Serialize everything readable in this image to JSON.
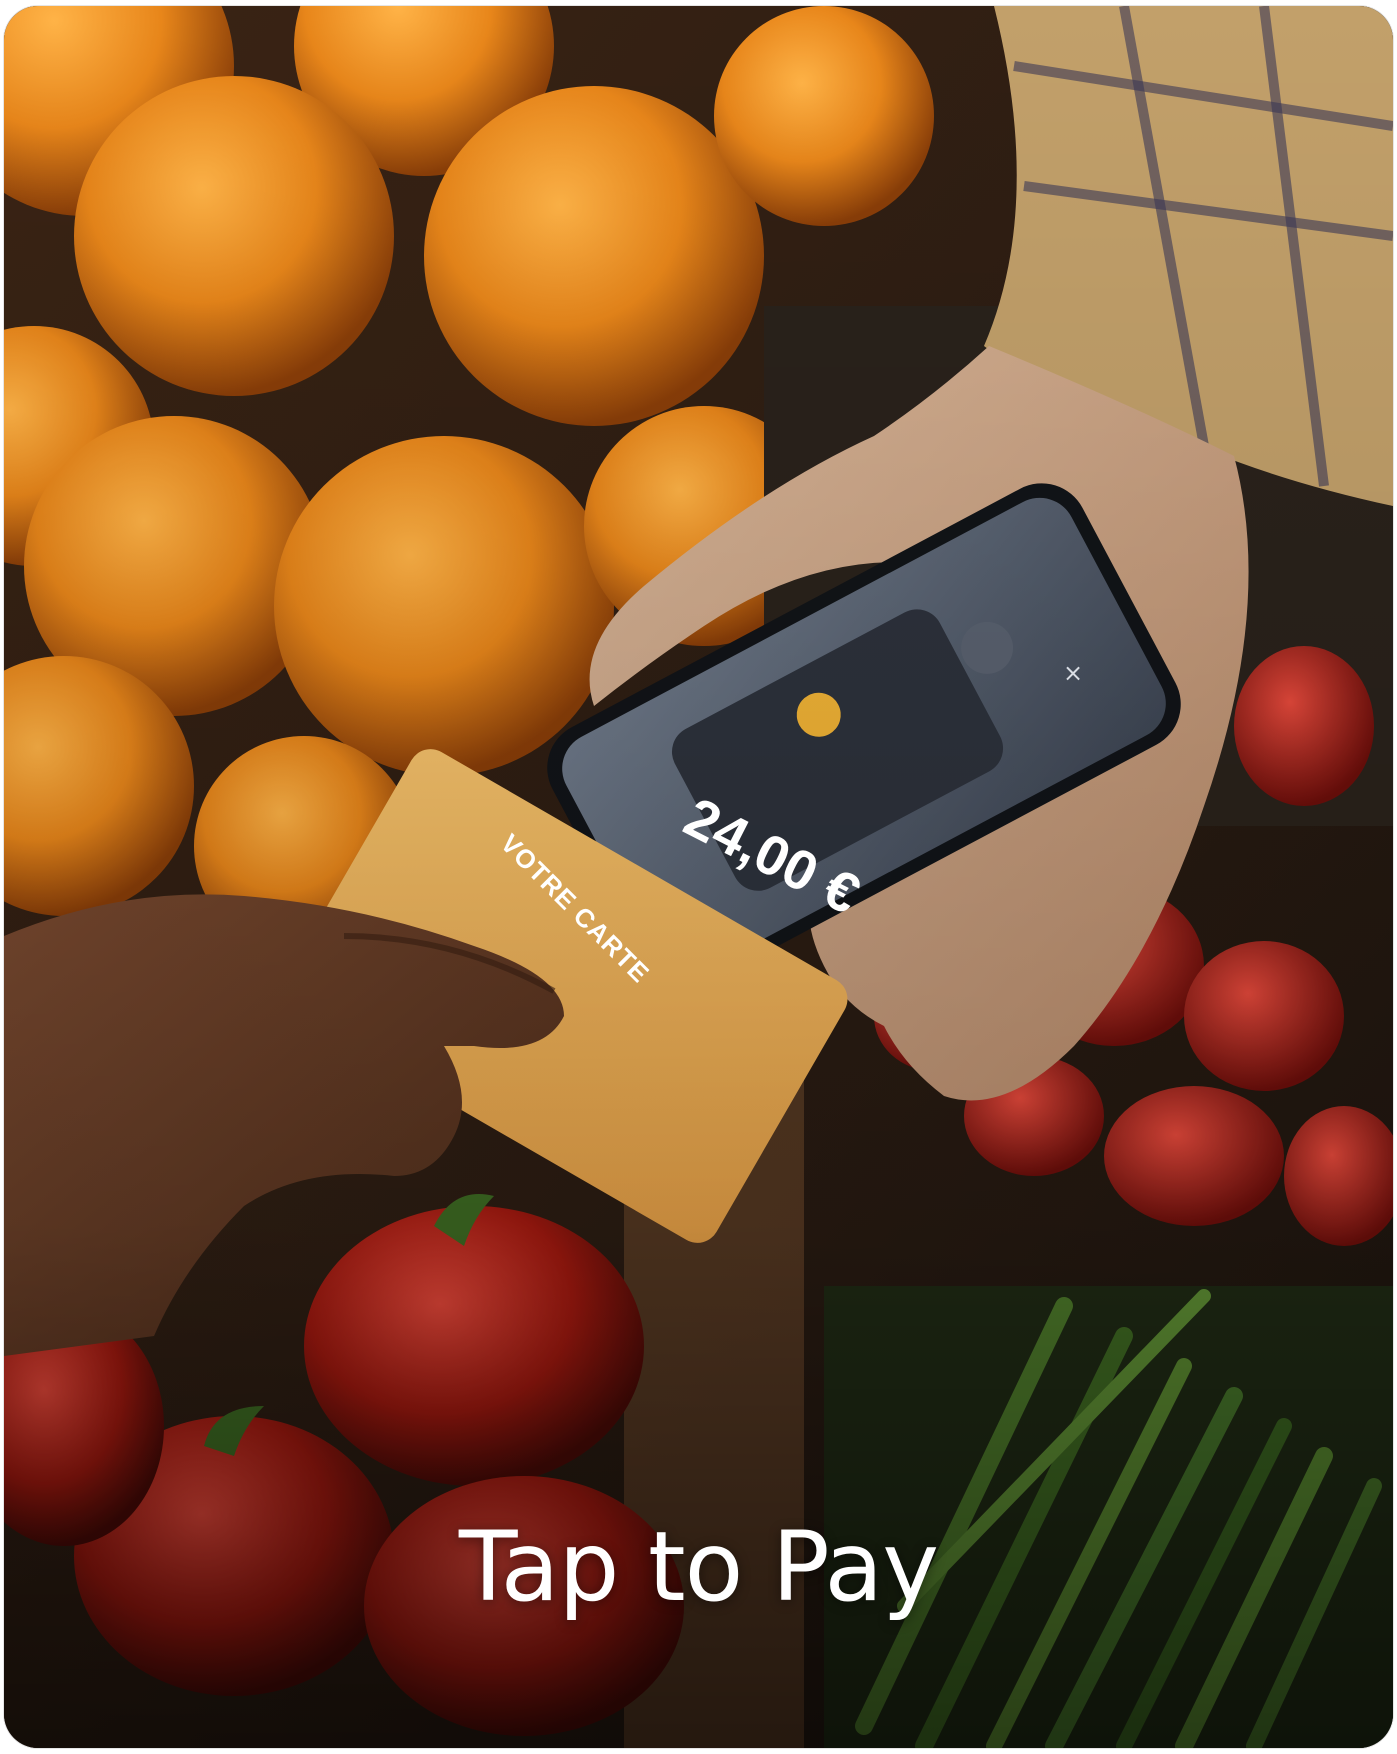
{
  "caption": "Tap to Pay",
  "phone_screen": {
    "amount": "24,00 €",
    "close_icon": "close-icon"
  },
  "card": {
    "label": "VOTRE CARTE",
    "color": "#F5B04A"
  },
  "colors": {
    "orange": "#E88A1C",
    "background_dark": "#2a1c14",
    "caption_text": "#FFFFFF"
  }
}
